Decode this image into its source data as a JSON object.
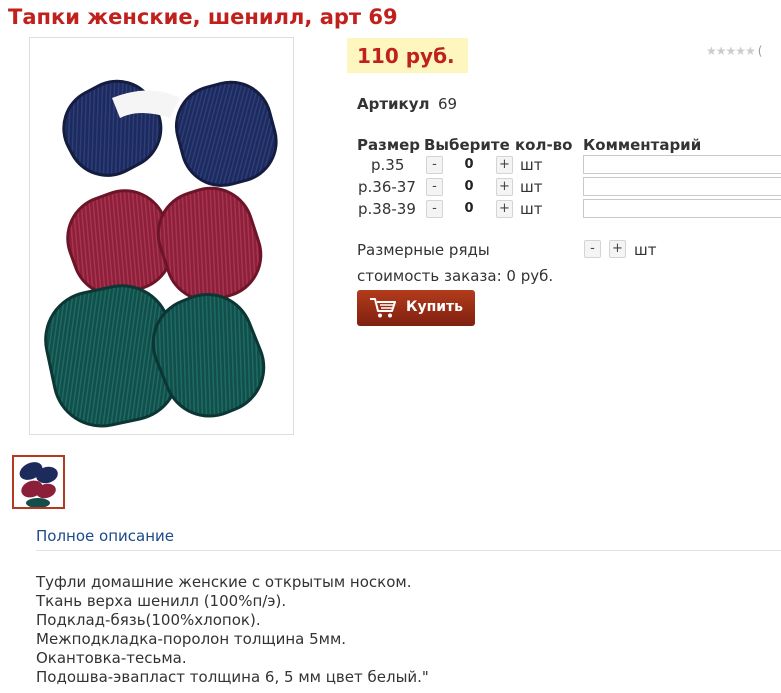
{
  "product": {
    "title": "Тапки женские, шенилл, арт 69",
    "price": "110 руб.",
    "rating_stars": "★★★★★",
    "rating_paren": "(",
    "sku_label": "Артикул",
    "sku_value": "69"
  },
  "sizes_table": {
    "headers": [
      "Размер",
      "Выберите кол-во",
      "Комментарий"
    ],
    "rows": [
      {
        "size": "р.35",
        "qty": "0",
        "unit": "шт"
      },
      {
        "size": "р.36-37",
        "qty": "0",
        "unit": "шт"
      },
      {
        "size": "р.38-39",
        "qty": "0",
        "unit": "шт"
      }
    ],
    "minus_label": "-",
    "plus_label": "+"
  },
  "size_runs": {
    "label": "Размерные ряды",
    "unit": "шт"
  },
  "order": {
    "total_text": "стоимость заказа: 0 руб."
  },
  "buy_button": {
    "label": "Купить"
  },
  "description": {
    "link": "Полное описание",
    "lines": [
      "Туфли домашние женские с открытым носком.",
      "Ткань верха шенилл (100%п/э).",
      "Подклад-бязь(100%хлопок).",
      "Межподкладка-поролон толщина 5мм.",
      "Окантовка-тесьма.",
      "Подошва-эвапласт толщина 6, 5 мм цвет белый.\""
    ]
  },
  "colors": {
    "title": "#c0211d",
    "price_bg": "#fdf6be",
    "buy_button": "#9a2c15",
    "link": "#1a4a8c",
    "slipper_navy": "#1d2a5c",
    "slipper_burgundy": "#8c1f3a",
    "slipper_teal": "#124e4a"
  }
}
